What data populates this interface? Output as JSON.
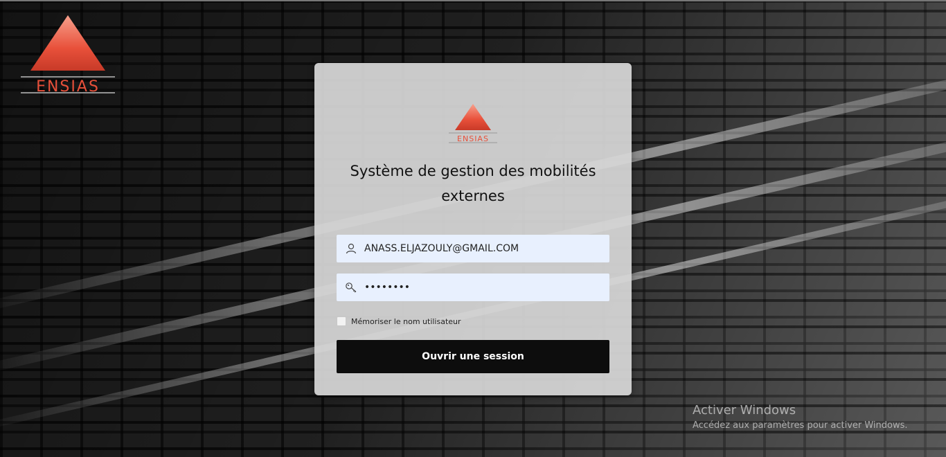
{
  "brand": {
    "logo_text": "ENSIAS"
  },
  "login": {
    "title": "Système de gestion des mobilités externes",
    "username_value": "ANASS.ELJAZOULY@GMAIL.COM",
    "password_value": "password",
    "remember_label": "Mémoriser le nom utilisateur",
    "remember_checked": false,
    "submit_label": "Ouvrir une session"
  },
  "windows_activation": {
    "title": "Activer Windows",
    "subtitle": "Accédez aux paramètres pour activer Windows."
  },
  "icons": {
    "username": "user-icon",
    "password": "key-icon"
  },
  "colors": {
    "logo_red": "#e8503a",
    "button_bg": "#0d0d0d",
    "field_bg": "#e8f0fe",
    "card_bg": "#d7d7d7"
  }
}
